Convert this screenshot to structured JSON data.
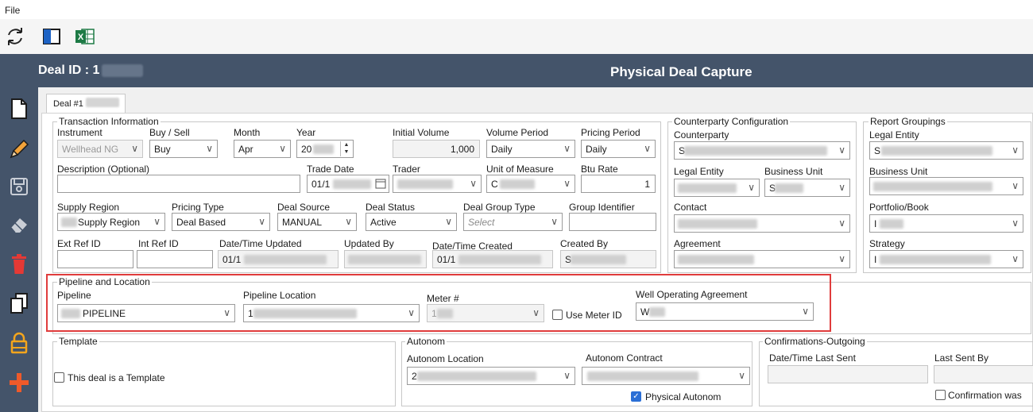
{
  "menu": {
    "file": "File"
  },
  "toolbar": {
    "icons": [
      "refresh-icon",
      "panel-layout-icon",
      "excel-icon"
    ]
  },
  "header": {
    "deal_id_label": "Deal ID : 1",
    "title": "Physical Deal Capture"
  },
  "sidebar": {
    "icons": [
      "new-document-icon",
      "pencil-edit-icon",
      "save-icon",
      "eraser-icon",
      "delete-icon",
      "copy-icon",
      "lock-icon",
      "add-icon"
    ]
  },
  "tab": {
    "label": "Deal #1"
  },
  "transaction": {
    "title": "Transaction Information",
    "instrument_label": "Instrument",
    "instrument_value": "Wellhead NG",
    "buysell_label": "Buy / Sell",
    "buysell_value": "Buy",
    "month_label": "Month",
    "month_value": "Apr",
    "year_label": "Year",
    "year_value": "20",
    "initial_volume_label": "Initial Volume",
    "initial_volume_value": "1,000",
    "volume_period_label": "Volume Period",
    "volume_period_value": "Daily",
    "pricing_period_label": "Pricing Period",
    "pricing_period_value": "Daily",
    "description_label": "Description (Optional)",
    "description_value": "",
    "trade_date_label": "Trade Date",
    "trade_date_value": "01/1",
    "trader_label": "Trader",
    "uom_label": "Unit of Measure",
    "uom_value": "C",
    "btu_label": "Btu Rate",
    "btu_value": "1",
    "supply_region_label": "Supply Region",
    "supply_region_value": "Supply Region",
    "pricing_type_label": "Pricing Type",
    "pricing_type_value": "Deal Based",
    "deal_source_label": "Deal Source",
    "deal_source_value": "MANUAL",
    "deal_status_label": "Deal Status",
    "deal_status_value": "Active",
    "deal_group_type_label": "Deal Group Type",
    "deal_group_type_placeholder": "Select",
    "group_identifier_label": "Group Identifier",
    "ext_ref_label": "Ext Ref ID",
    "int_ref_label": "Int Ref ID",
    "updated_label": "Date/Time Updated",
    "updated_value": "01/1",
    "updated_by_label": "Updated By",
    "created_label": "Date/Time Created",
    "created_value": "01/1",
    "created_by_label": "Created By",
    "created_by_value": "S"
  },
  "counterparty": {
    "title": "Counterparty Configuration",
    "counterparty_label": "Counterparty",
    "counterparty_value": "S",
    "legal_entity_label": "Legal Entity",
    "business_unit_label": "Business Unit",
    "business_unit_value": "S",
    "contact_label": "Contact",
    "agreement_label": "Agreement"
  },
  "report": {
    "title": "Report Groupings",
    "legal_entity_label": "Legal Entity",
    "legal_entity_value": "S",
    "business_unit_label": "Business Unit",
    "portfolio_label": "Portfolio/Book",
    "portfolio_value": "I",
    "strategy_label": "Strategy",
    "strategy_value": "I"
  },
  "pipeline": {
    "title": "Pipeline and Location",
    "pipeline_label": "Pipeline",
    "pipeline_value": "PIPELINE",
    "location_label": "Pipeline Location",
    "location_value": "1",
    "meter_label": "Meter #",
    "meter_value": "1",
    "use_meter_label": "Use Meter ID",
    "woa_label": "Well Operating Agreement",
    "woa_value": "W"
  },
  "template": {
    "title": "Template",
    "checkbox_label": "This deal is a Template"
  },
  "autonom": {
    "title": "Autonom",
    "location_label": "Autonom Location",
    "location_value": "2",
    "contract_label": "Autonom Contract",
    "physical_label": "Physical Autonom"
  },
  "confirmations": {
    "title": "Confirmations-Outgoing",
    "last_sent_label": "Date/Time Last Sent",
    "last_sent_by_label": "Last Sent By",
    "confirmation_label": "Confirmation was"
  },
  "colors": {
    "header": "#44546a",
    "highlight": "#e03c3c",
    "checkbox": "#2b6fd6"
  }
}
